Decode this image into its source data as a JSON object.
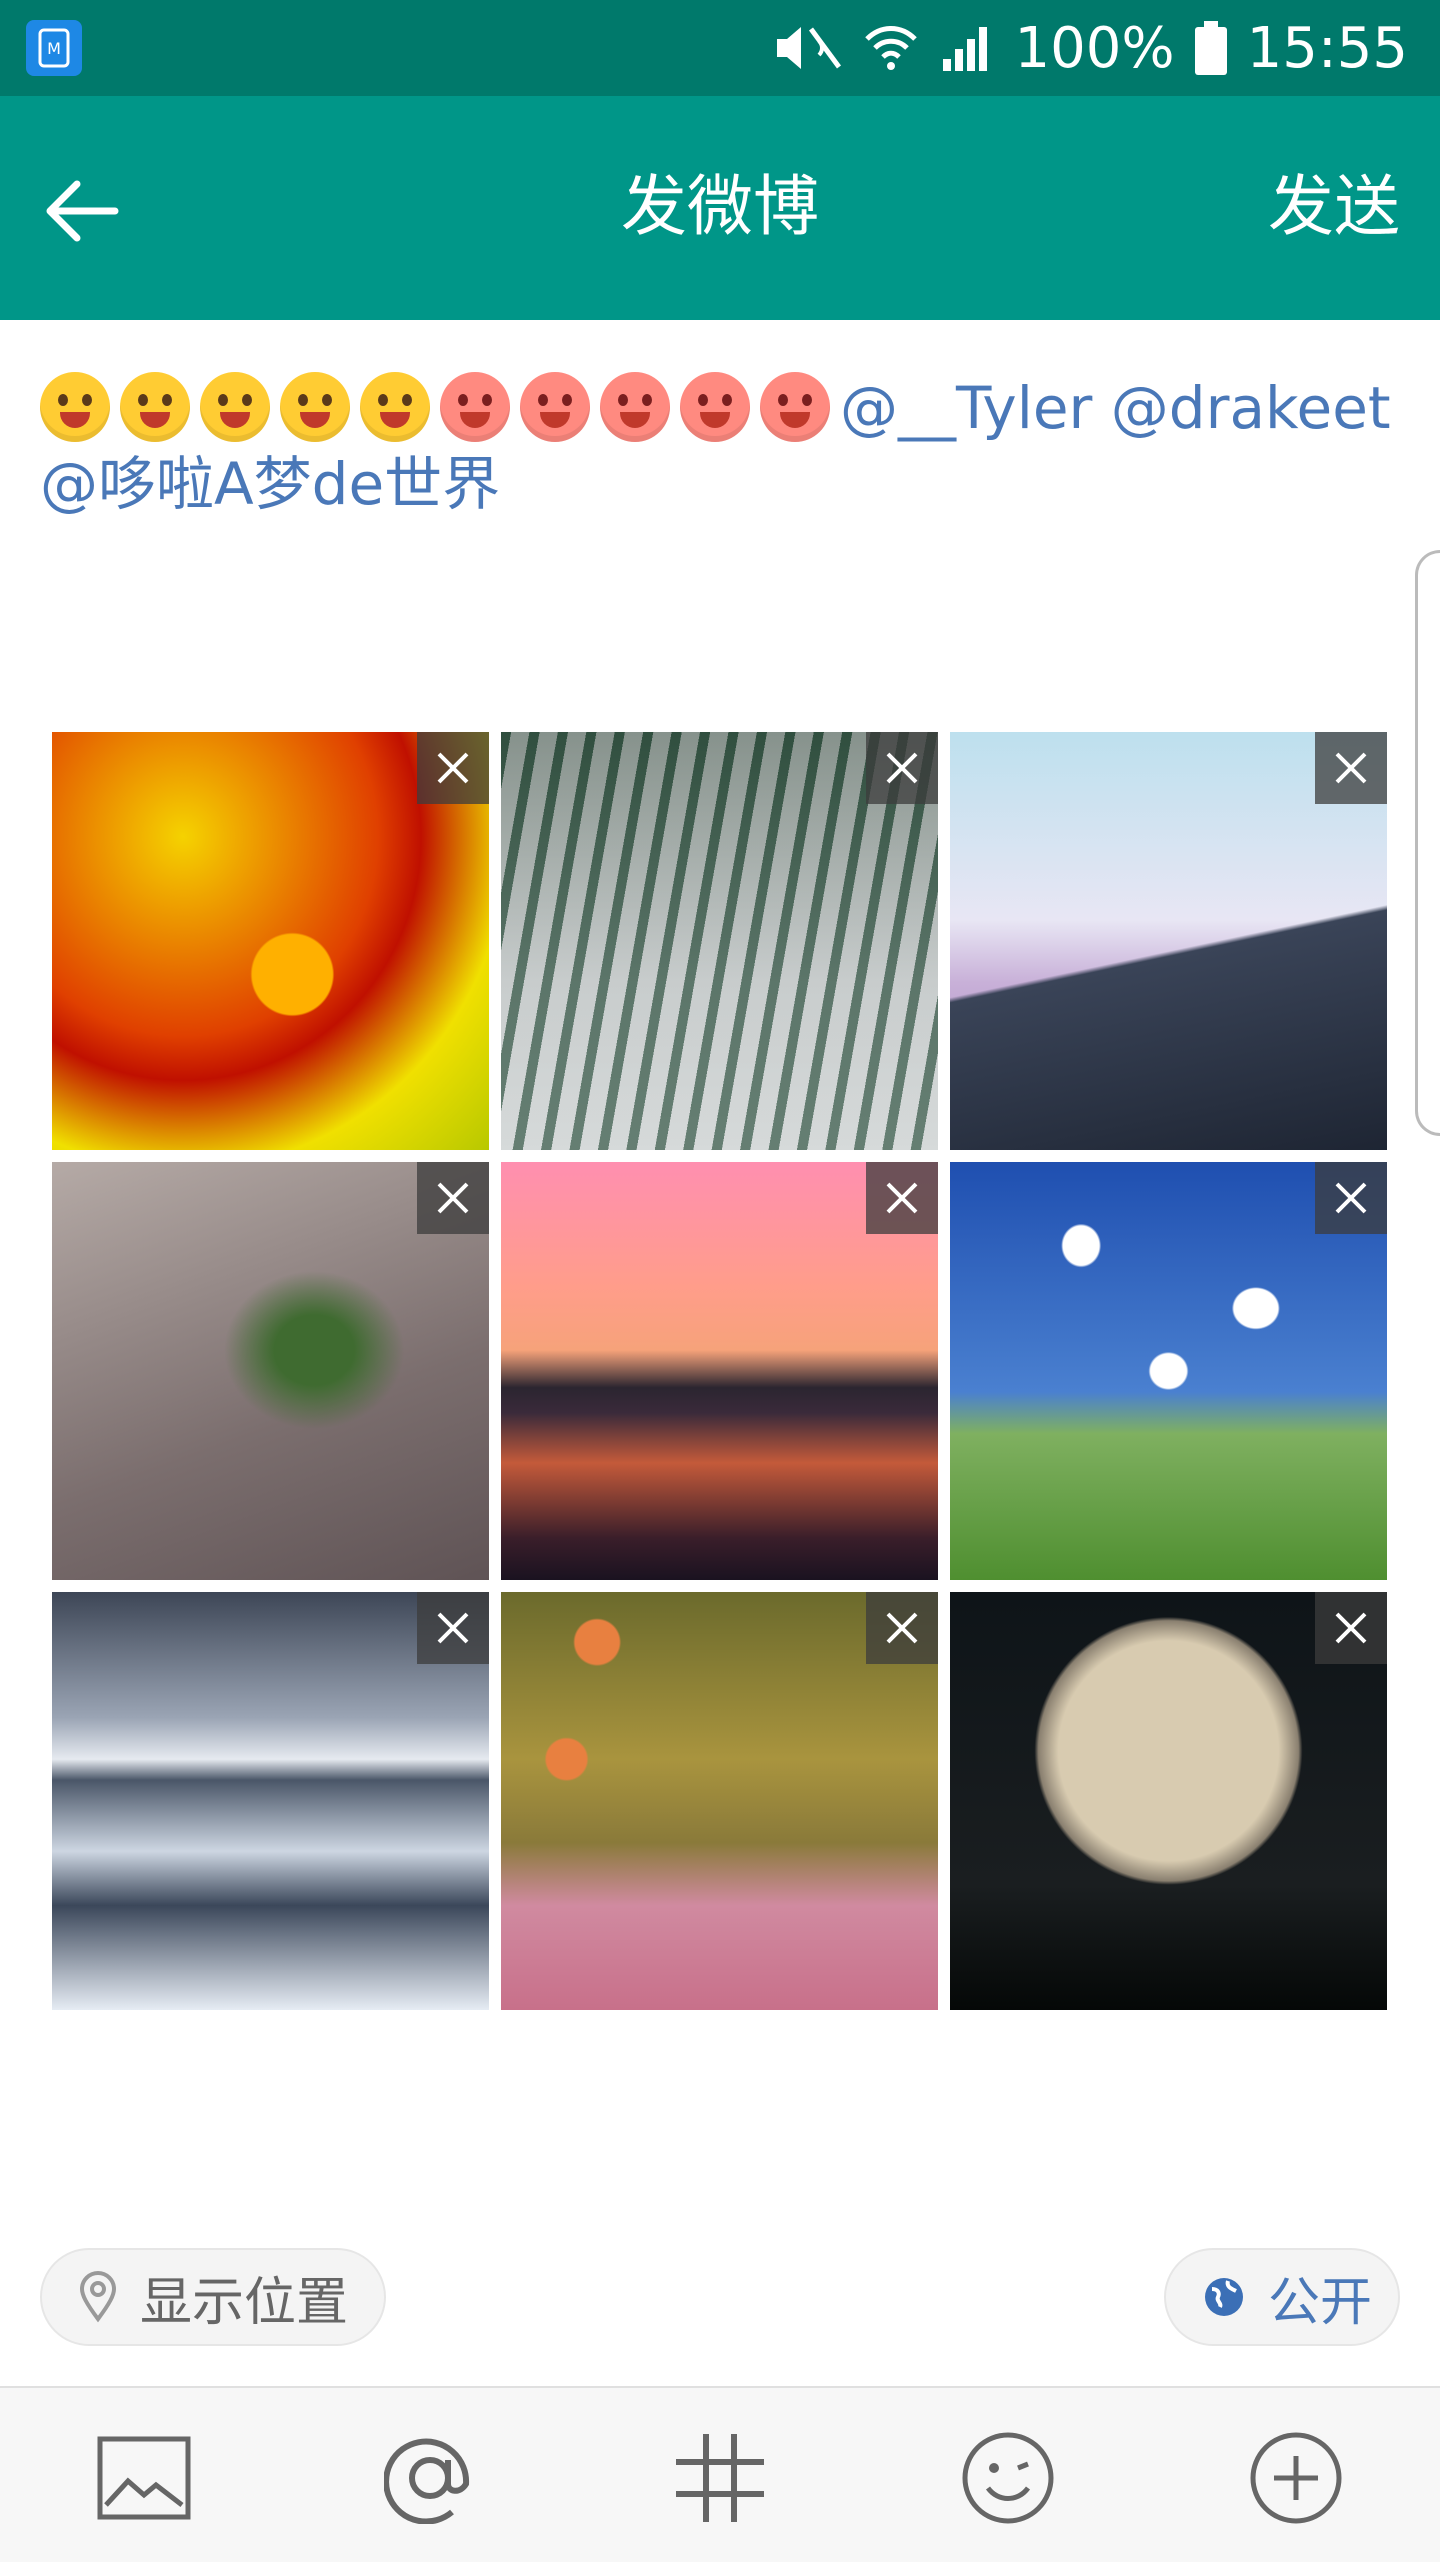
{
  "status_bar": {
    "battery": "100%",
    "time": "15:55",
    "app_icon": "m-app-icon",
    "icons": [
      "mute-icon",
      "wifi-icon",
      "signal-icon",
      "battery-icon"
    ]
  },
  "app_bar": {
    "back_icon": "arrow-left-icon",
    "title": "发微博",
    "send_label": "发送"
  },
  "compose": {
    "emoji_count": 10,
    "mentions_line1": "@__Tyler @drakeet",
    "mentions_line2": "@哆啦A梦de世界"
  },
  "images": [
    {
      "name": "yellow-petal-water-drop",
      "close_icon": "close-icon"
    },
    {
      "name": "misty-forest",
      "close_icon": "close-icon"
    },
    {
      "name": "mountain-rainbow-sky",
      "close_icon": "close-icon"
    },
    {
      "name": "leaves-with-droplets",
      "close_icon": "close-icon"
    },
    {
      "name": "pink-sunset-lake",
      "close_icon": "close-icon"
    },
    {
      "name": "blue-sky-green-meadow",
      "close_icon": "close-icon"
    },
    {
      "name": "snowy-mountain-coast",
      "close_icon": "close-icon"
    },
    {
      "name": "lanterns-pink-flowers",
      "close_icon": "close-icon"
    },
    {
      "name": "moon-tree-silhouette",
      "close_icon": "close-icon"
    }
  ],
  "location_chip": {
    "icon": "location-pin-icon",
    "label": "显示位置"
  },
  "privacy_chip": {
    "icon": "globe-icon",
    "label": "公开"
  },
  "toolbar": {
    "items": [
      "image-icon",
      "at-icon",
      "hashtag-icon",
      "emoji-icon",
      "plus-icon"
    ]
  },
  "colors": {
    "status_bar": "#00796B",
    "app_bar": "#009688",
    "mention": "#4a78b8"
  }
}
